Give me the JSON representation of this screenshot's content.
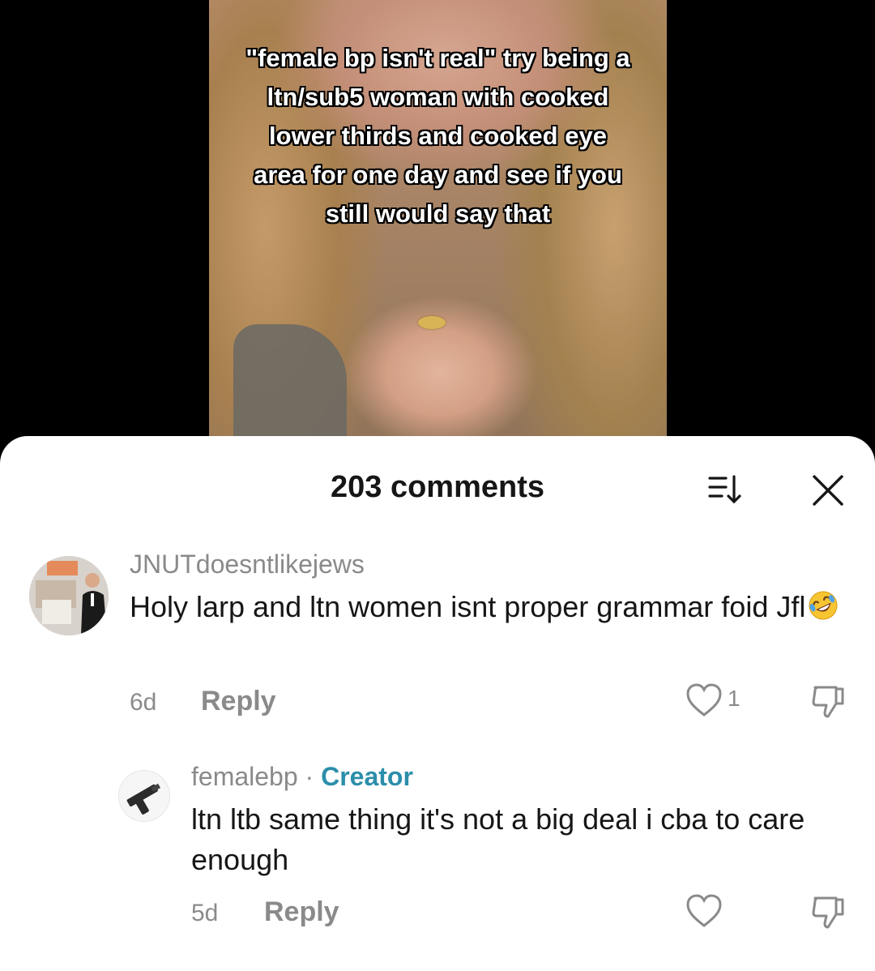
{
  "video": {
    "overlay_text": "\"female bp isn't real\" try being a ltn/sub5 woman with cooked lower thirds and cooked eye area for one day and see if you still would say that"
  },
  "comments_panel": {
    "title": "203 comments",
    "sort_icon": "sort-icon",
    "close_icon": "close-icon",
    "comments": [
      {
        "username": "JNUTdoesntlikejews",
        "text": "Holy larp and ltn women isnt proper grammar foid Jfl",
        "emoji": "rolling-on-floor-laughing-emoji",
        "time": "6d",
        "reply_label": "Reply",
        "like_count": "1"
      },
      {
        "username": "femalebp",
        "separator": "·",
        "creator_label": "Creator",
        "text": "ltn ltb same thing it's not a big deal i cba to care enough",
        "time": "5d",
        "reply_label": "Reply"
      }
    ]
  },
  "colors": {
    "creator_accent": "#2b8eaa",
    "muted_text": "#8a8a8a",
    "primary_text": "#161616"
  }
}
